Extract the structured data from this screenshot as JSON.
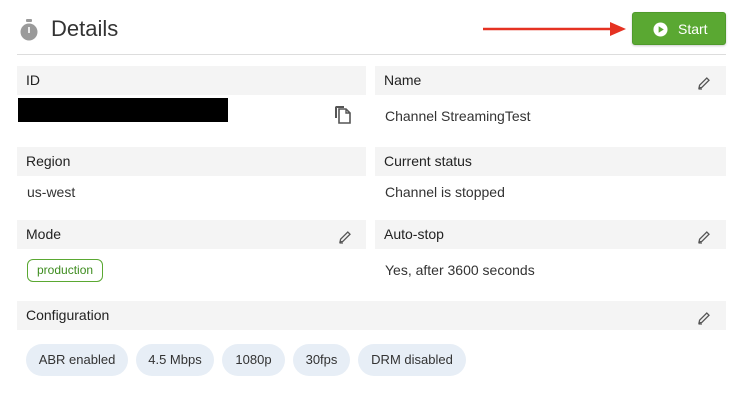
{
  "header": {
    "title": "Details",
    "title_icon": "stopwatch-icon",
    "start_button": {
      "label": "Start",
      "icon": "play-circle-icon",
      "color": "#5aa832"
    },
    "annotation_arrow_color": "#e53222"
  },
  "fields": {
    "id": {
      "label": "ID",
      "value_redacted": true,
      "action_icon": "copy-icon"
    },
    "name": {
      "label": "Name",
      "value": "Channel StreamingTest",
      "action_icon": "pencil-icon"
    },
    "region": {
      "label": "Region",
      "value": "us-west"
    },
    "current_status": {
      "label": "Current status",
      "value": "Channel is stopped"
    },
    "mode": {
      "label": "Mode",
      "value": "production",
      "action_icon": "pencil-icon"
    },
    "auto_stop": {
      "label": "Auto-stop",
      "value": "Yes, after 3600 seconds",
      "action_icon": "pencil-icon"
    },
    "configuration": {
      "label": "Configuration",
      "action_icon": "pencil-icon",
      "chips": [
        "ABR enabled",
        "4.5 Mbps",
        "1080p",
        "30fps",
        "DRM disabled"
      ]
    }
  }
}
